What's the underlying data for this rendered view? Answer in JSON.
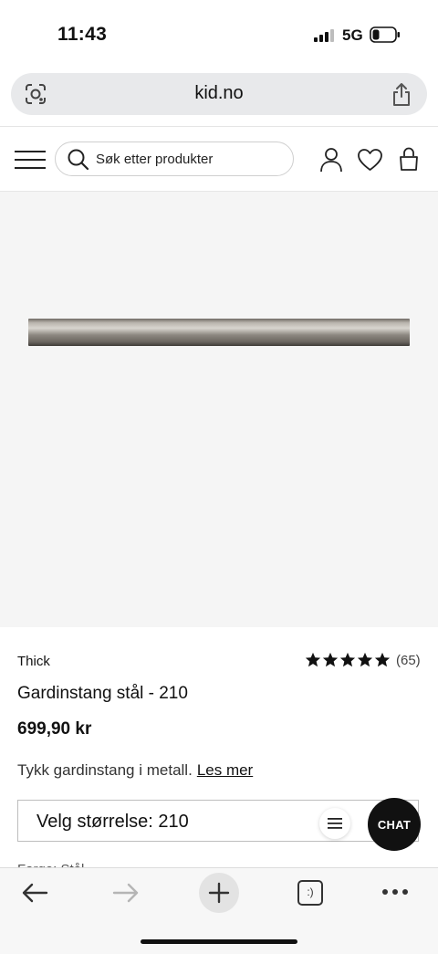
{
  "status_bar": {
    "time": "11:43",
    "network": "5G"
  },
  "browser": {
    "url": "kid.no",
    "tabs_count_label": ":)"
  },
  "header": {
    "search_placeholder": "Søk etter produkter"
  },
  "product": {
    "brand": "Thick",
    "rating_stars": 5,
    "review_count": "(65)",
    "title": "Gardinstang stål - 210",
    "price": "699,90 kr",
    "description": "Tykk gardinstang i metall.",
    "read_more": "Les mer",
    "size_select_label": "Velg størrelse: 210",
    "partial_next_line": "Farge: Stål"
  },
  "chat": {
    "label": "CHAT"
  },
  "colors": {
    "page_bg": "#ffffff",
    "image_bg": "#f5f5f5",
    "chat_bg": "#111111",
    "url_bar_bg": "#e8e9eb"
  },
  "icons": [
    "signal-icon",
    "battery-icon",
    "google-lens-icon",
    "share-icon",
    "hamburger-menu-icon",
    "search-icon",
    "account-icon",
    "heart-icon",
    "shopping-bag-icon",
    "star-icon",
    "list-icon",
    "back-arrow-icon",
    "forward-arrow-icon",
    "plus-icon",
    "tabs-icon",
    "more-icon"
  ]
}
